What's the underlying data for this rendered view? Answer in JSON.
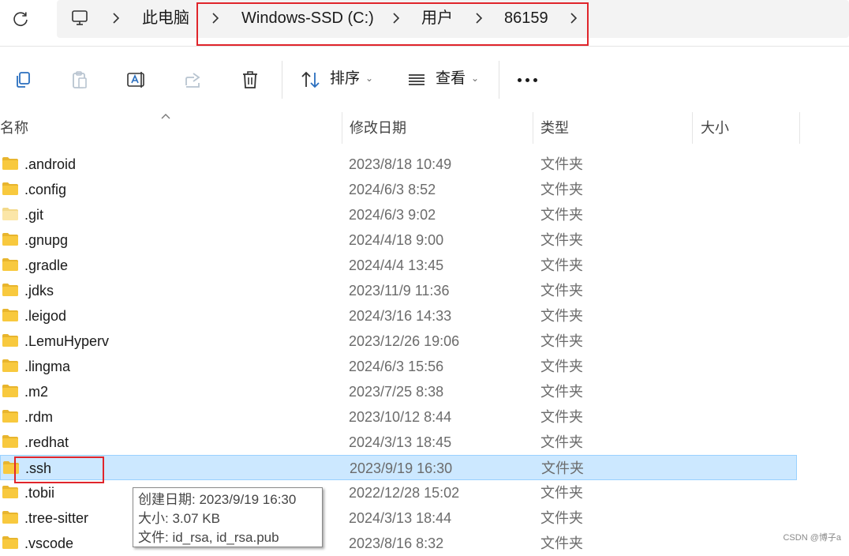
{
  "address_bar": {
    "breadcrumbs": [
      "此电脑",
      "Windows-SSD (C:)",
      "用户",
      "86159"
    ]
  },
  "toolbar": {
    "sort_label": "排序",
    "view_label": "查看"
  },
  "columns": {
    "name": "名称",
    "date": "修改日期",
    "type": "类型",
    "size": "大小"
  },
  "files": [
    {
      "name": ".android",
      "date": "2023/8/18 10:49",
      "type": "文件夹"
    },
    {
      "name": ".config",
      "date": "2024/6/3 8:52",
      "type": "文件夹"
    },
    {
      "name": ".git",
      "date": "2024/6/3 9:02",
      "type": "文件夹"
    },
    {
      "name": ".gnupg",
      "date": "2024/4/18 9:00",
      "type": "文件夹"
    },
    {
      "name": ".gradle",
      "date": "2024/4/4 13:45",
      "type": "文件夹"
    },
    {
      "name": ".jdks",
      "date": "2023/11/9 11:36",
      "type": "文件夹"
    },
    {
      "name": ".leigod",
      "date": "2024/3/16 14:33",
      "type": "文件夹"
    },
    {
      "name": ".LemuHyperv",
      "date": "2023/12/26 19:06",
      "type": "文件夹"
    },
    {
      "name": ".lingma",
      "date": "2024/6/3 15:56",
      "type": "文件夹"
    },
    {
      "name": ".m2",
      "date": "2023/7/25 8:38",
      "type": "文件夹"
    },
    {
      "name": ".rdm",
      "date": "2023/10/12 8:44",
      "type": "文件夹"
    },
    {
      "name": ".redhat",
      "date": "2024/3/13 18:45",
      "type": "文件夹"
    },
    {
      "name": ".ssh",
      "date": "2023/9/19 16:30",
      "type": "文件夹",
      "selected": true
    },
    {
      "name": ".tobii",
      "date": "2022/12/28 15:02",
      "type": "文件夹"
    },
    {
      "name": ".tree-sitter",
      "date": "2024/3/13 18:44",
      "type": "文件夹"
    },
    {
      "name": ".vscode",
      "date": "2023/8/16 8:32",
      "type": "文件夹"
    }
  ],
  "tooltip": {
    "created": "创建日期: 2023/9/19 16:30",
    "size": "大小: 3.07 KB",
    "files": "文件: id_rsa, id_rsa.pub"
  },
  "watermark": "CSDN @博子a",
  "colors": {
    "selection_bg": "#cce8ff",
    "folder": "#f8c93e",
    "highlight_box": "#e0252b"
  }
}
